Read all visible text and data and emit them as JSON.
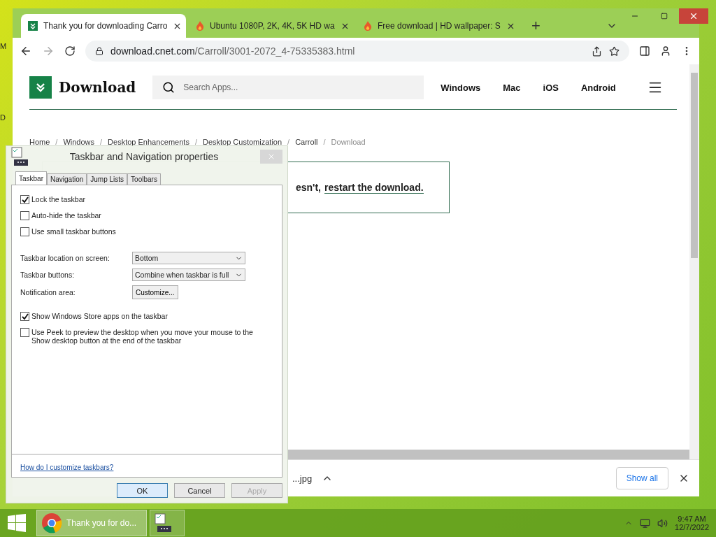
{
  "desktop_labels": [
    "M",
    "D"
  ],
  "browser": {
    "tabs": [
      {
        "title": "Thank you for downloading Carro",
        "selected": true,
        "kind": "download"
      },
      {
        "title": "Ubuntu 1080P, 2K, 4K, 5K HD wa",
        "selected": false,
        "kind": "flame"
      },
      {
        "title": "Free download | HD wallpaper: S",
        "selected": false,
        "kind": "flame"
      }
    ],
    "new_tab": "+",
    "address": {
      "domain": "download.cnet.com",
      "path": "/Carroll/3001-2072_4-75335383.html"
    }
  },
  "page": {
    "logo": "Download",
    "search": {
      "placeholder": "Search Apps..."
    },
    "nav": [
      "Windows",
      "Mac",
      "iOS",
      "Android"
    ],
    "breadcrumb_separator": "/",
    "breadcrumb": [
      {
        "label": "Home",
        "current": false
      },
      {
        "label": "Windows",
        "current": false
      },
      {
        "label": "Desktop Enhancements",
        "current": false
      },
      {
        "label": "Desktop Customization",
        "current": false
      },
      {
        "label": "Carroll",
        "current": false
      },
      {
        "label": "Download",
        "current": true
      }
    ],
    "message": {
      "text": "esn't,",
      "link": "restart the download."
    }
  },
  "shelf": {
    "items": [
      {
        "name": "...jpg"
      }
    ],
    "show_all": "Show all"
  },
  "dialog": {
    "title": "Taskbar and Navigation properties",
    "tabs": [
      {
        "label": "Taskbar",
        "selected": true
      },
      {
        "label": "Navigation",
        "selected": false
      },
      {
        "label": "Jump Lists",
        "selected": false
      },
      {
        "label": "Toolbars",
        "selected": false
      }
    ],
    "options": [
      {
        "kind": "checkbox",
        "label": "Lock the taskbar",
        "checked": true
      },
      {
        "kind": "checkbox",
        "label": "Auto-hide the taskbar",
        "checked": false
      },
      {
        "kind": "checkbox",
        "label": "Use small taskbar buttons",
        "checked": false
      },
      {
        "kind": "select",
        "label": "Taskbar location on screen:",
        "value": "Bottom"
      },
      {
        "kind": "select",
        "label": "Taskbar buttons:",
        "value": "Combine when taskbar is full"
      },
      {
        "kind": "button",
        "label": "Notification area:",
        "value": "Customize..."
      },
      {
        "kind": "checkbox",
        "label": "Show Windows Store apps on the taskbar",
        "checked": true
      },
      {
        "kind": "checkbox",
        "label": "Use Peek to preview the desktop when you move your mouse to the Show desktop button at the end of the taskbar",
        "checked": false
      }
    ],
    "help_link": "How do I customize taskbars?",
    "buttons": [
      {
        "label": "OK",
        "disabled": false,
        "default": true
      },
      {
        "label": "Cancel",
        "disabled": false,
        "default": false
      },
      {
        "label": "Apply",
        "disabled": true,
        "default": false
      }
    ]
  },
  "taskbar": {
    "items": [
      {
        "kind": "chrome",
        "label": "Thank you for do...",
        "selected": true
      },
      {
        "kind": "settings",
        "selected": false
      }
    ],
    "time": "9:47 AM",
    "date": "12/7/2022"
  }
}
